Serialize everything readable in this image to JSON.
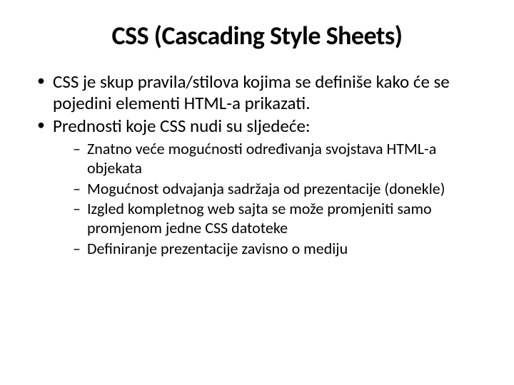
{
  "title": "CSS (Cascading Style Sheets)",
  "bullets": [
    "CSS je skup pravila/stilova kojima se definiše kako će se pojedini elementi HTML-a prikazati.",
    "Prednosti koje CSS nudi su sljedeće:"
  ],
  "subbullets": [
    "Znatno veće mogućnosti određivanja svojstava HTML-a objekata",
    "Mogućnost odvajanja sadržaja od prezentacije (donekle)",
    "Izgled kompletnog web sajta se može promjeniti samo promjenom jedne CSS datoteke",
    "Definiranje prezentacije zavisno o mediju"
  ]
}
